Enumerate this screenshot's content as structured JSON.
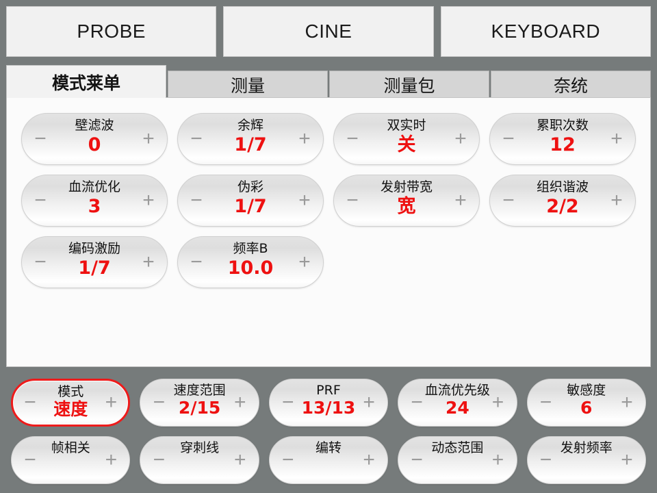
{
  "theme": {
    "background": "#767b7b",
    "panel_bg": "#fbfbfb",
    "tab_inactive_bg": "#d5d5d5",
    "tab_active_bg": "#f2f2f2",
    "value_red": "#ee1111",
    "selected_outline": "#ee1b1b"
  },
  "topbar": {
    "buttons": [
      {
        "label": "PROBE"
      },
      {
        "label": "CINE"
      },
      {
        "label": "KEYBOARD"
      }
    ]
  },
  "tabs": [
    {
      "label": "模式莱单",
      "active": true
    },
    {
      "label": "测量",
      "active": false
    },
    {
      "label": "测量包",
      "active": false
    },
    {
      "label": "奈统",
      "active": false
    }
  ],
  "main_controls": [
    {
      "label": "壁滤波",
      "value": "0"
    },
    {
      "label": "余辉",
      "value": "1/7"
    },
    {
      "label": "双实时",
      "value": "关"
    },
    {
      "label": "累职次数",
      "value": "12"
    },
    {
      "label": "血流优化",
      "value": "3"
    },
    {
      "label": "伪彩",
      "value": "1/7"
    },
    {
      "label": "发射带宽",
      "value": "宽"
    },
    {
      "label": "组织谐波",
      "value": "2/2"
    },
    {
      "label": "编码激励",
      "value": "1/7"
    },
    {
      "label": "频率B",
      "value": "10.0"
    }
  ],
  "bottom_controls": [
    {
      "label": "模式",
      "value": "速度",
      "selected": true
    },
    {
      "label": "速度范围",
      "value": "2/15",
      "selected": false
    },
    {
      "label": "PRF",
      "value": "13/13",
      "selected": false
    },
    {
      "label": "血流优先级",
      "value": "24",
      "selected": false
    },
    {
      "label": "敏感度",
      "value": "6",
      "selected": false
    },
    {
      "label": "帧相关",
      "value": "",
      "selected": false
    },
    {
      "label": "穿刺线",
      "value": "",
      "selected": false
    },
    {
      "label": "编转",
      "value": "",
      "selected": false
    },
    {
      "label": "动态范围",
      "value": "",
      "selected": false
    },
    {
      "label": "发射频率",
      "value": "",
      "selected": false
    }
  ],
  "icons": {
    "decrement": "−",
    "increment": "+"
  }
}
